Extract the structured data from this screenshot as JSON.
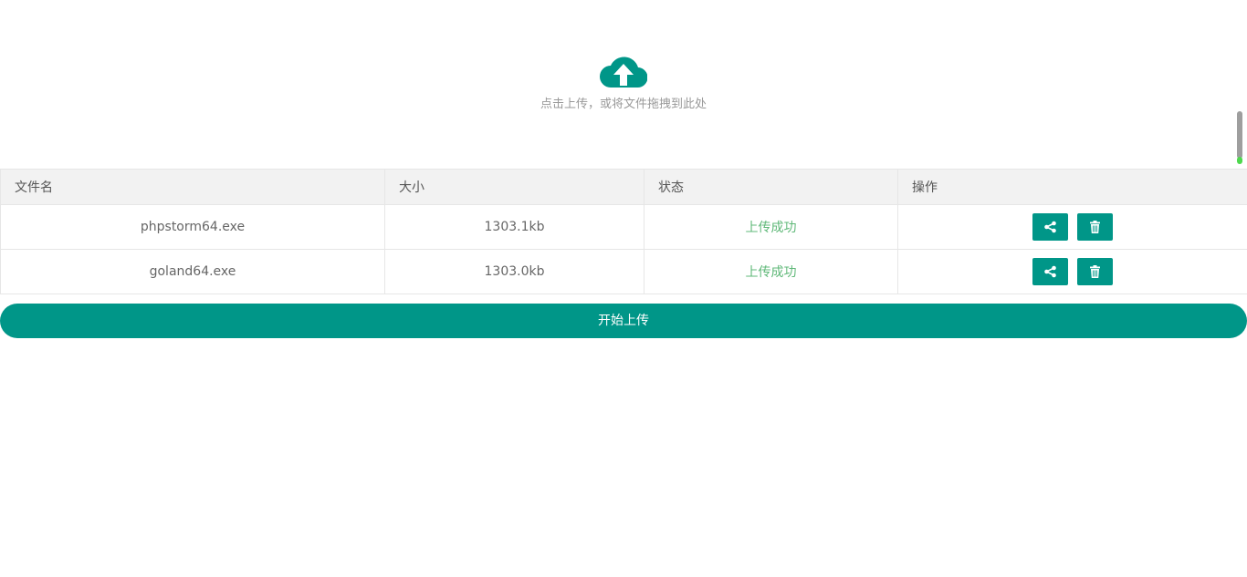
{
  "upload": {
    "hint": "点击上传，或将文件拖拽到此处",
    "icon": "cloud-upload-icon"
  },
  "table": {
    "columns": [
      "文件名",
      "大小",
      "状态",
      "操作"
    ],
    "rows": [
      {
        "name": "phpstorm64.exe",
        "size": "1303.1kb",
        "status": "上传成功"
      },
      {
        "name": "goland64.exe",
        "size": "1303.0kb",
        "status": "上传成功"
      }
    ],
    "actions": [
      "share-icon",
      "trash-icon"
    ]
  },
  "start_button": {
    "label": "开始上传"
  },
  "colors": {
    "primary": "#009688",
    "success": "#5fb878",
    "header_bg": "#f2f2f2",
    "border": "#e6e6e6",
    "hint": "#999999"
  }
}
